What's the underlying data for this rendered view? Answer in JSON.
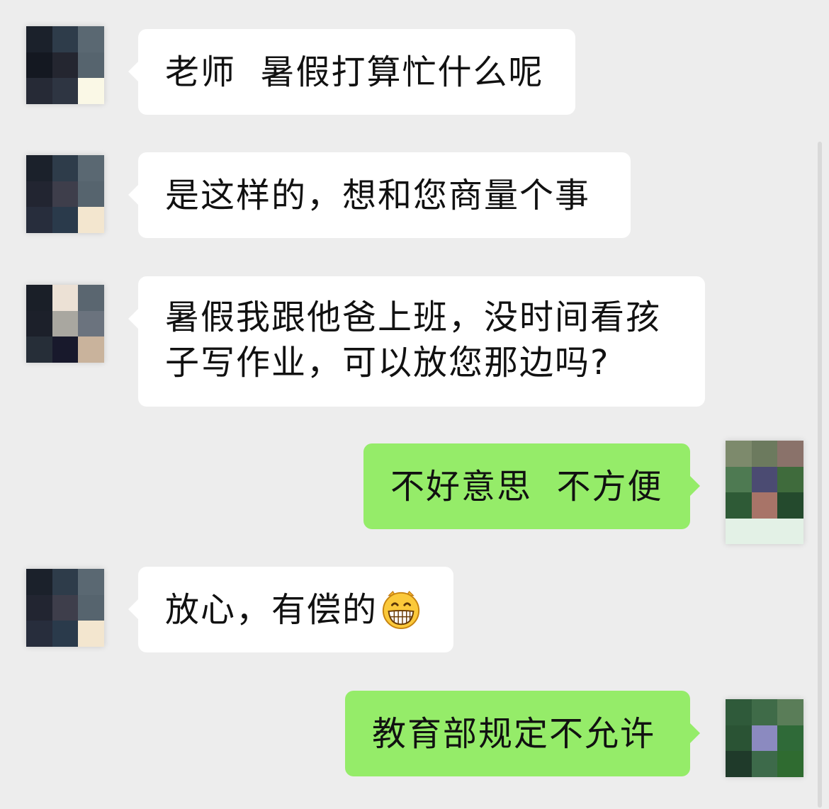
{
  "chat": {
    "messages": [
      {
        "id": "m1",
        "side": "incoming",
        "text": "老师  暑假打算忙什么呢",
        "emoji": ""
      },
      {
        "id": "m2",
        "side": "incoming",
        "text": "是这样的，想和您商量个事",
        "emoji": ""
      },
      {
        "id": "m3",
        "side": "incoming",
        "lines": [
          "暑假我跟他爸上班，没时间看孩",
          "子写作业，可以放您那边吗?"
        ],
        "emoji": ""
      },
      {
        "id": "m4",
        "side": "outgoing",
        "text": "不好意思  不方便",
        "emoji": ""
      },
      {
        "id": "m5",
        "side": "incoming",
        "text": "放心，有偿的",
        "emoji": "grinning-face-emoji"
      },
      {
        "id": "m6",
        "side": "outgoing",
        "text": "教育部规定不允许",
        "emoji": ""
      }
    ]
  },
  "avatars": {
    "parent_avatar": {
      "description": "pixelated-avatar",
      "palette": [
        "#1b212b",
        "#2e3c4a",
        "#5a6872",
        "#141821",
        "#242630",
        "#56646e",
        "#262a36",
        "#2e3542",
        "#faf8e6"
      ]
    },
    "parent_avatar_alt": {
      "palette": [
        "#1b212b",
        "#2e3c4a",
        "#5a6872",
        "#222531",
        "#3e3e4b",
        "#56646e",
        "#272d3c",
        "#2a3a4b",
        "#f3e6cf"
      ]
    },
    "parent_avatar_3": {
      "palette": [
        "#1a1f28",
        "#ece1d5",
        "#5a6670",
        "#1c202a",
        "#a9a7a0",
        "#6b737e",
        "#262e38",
        "#18192c",
        "#c9b39c"
      ]
    },
    "teacher_avatar": {
      "palette": [
        "#7d8a6c",
        "#6c7a5e",
        "#8a726a",
        "#4e7a52",
        "#4b4b72",
        "#3f6b3c",
        "#2e5a36",
        "#a87468",
        "#244a2d",
        "#e3f1e6",
        "#e3f1e6",
        "#e3f1e6"
      ]
    },
    "teacher_avatar_2": {
      "palette": [
        "#2f5a3a",
        "#3f6b48",
        "#5a7d58",
        "#2a5334",
        "#8b8ac0",
        "#2f6a38",
        "#1f3a2a",
        "#3d6a4a",
        "#2f6b30"
      ]
    }
  },
  "colors": {
    "background": "#ededed",
    "incoming_bubble": "#ffffff",
    "outgoing_bubble": "#95ec69",
    "text": "#111111"
  }
}
